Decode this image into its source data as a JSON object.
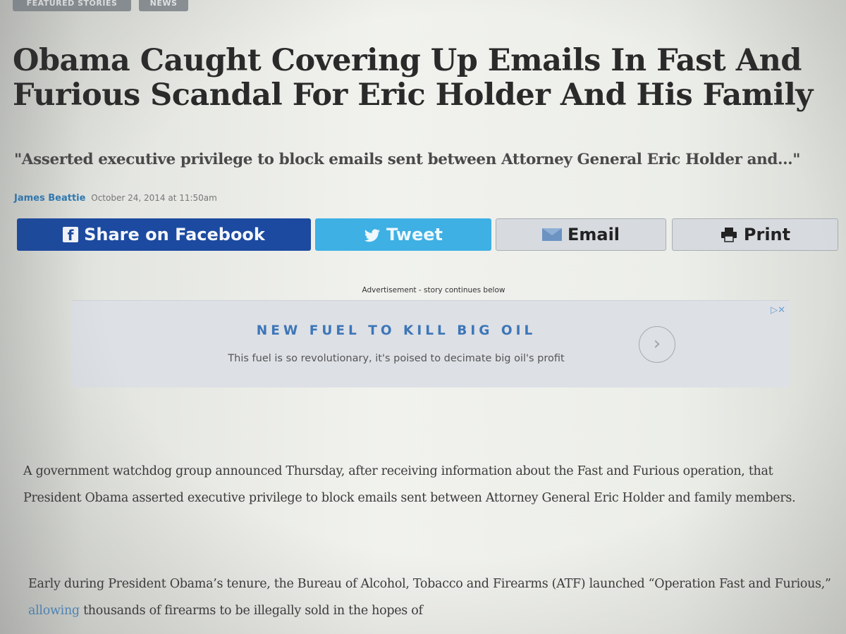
{
  "tags": [
    "FEATURED STORIES",
    "NEWS"
  ],
  "article": {
    "title": "Obama Caught Covering Up Emails In Fast And Furious Scandal For Eric Holder And His Family",
    "dek": "\"Asserted executive privilege to block emails sent between Attorney General Eric Holder and...\"",
    "author": "James Beattie",
    "date": "October 24, 2014 at 11:50am"
  },
  "share": {
    "facebook": "Share on Facebook",
    "twitter": "Tweet",
    "email": "Email",
    "print": "Print"
  },
  "ad": {
    "label": "Advertisement - story continues below",
    "close": "▷✕",
    "headline": "NEW FUEL TO KILL BIG OIL",
    "subtext": "This fuel is so revolutionary, it's poised to decimate big oil's profit",
    "arrow": "›"
  },
  "body": {
    "p1": "A government watchdog group announced Thursday, after receiving information about the Fast and Furious operation, that President Obama asserted executive privilege to block emails sent between Attorney General Eric Holder and family members.",
    "p2_before": "Early during President Obama’s tenure, the Bureau of Alcohol, Tobacco and Firearms (ATF) launched “Operation Fast and Furious,” ",
    "p2_link": "allowing",
    "p2_after": " thousands of firearms to be illegally sold in the hopes of"
  },
  "colors": {
    "facebook": "#1c4aa0",
    "twitter": "#3eb0e4",
    "link": "#2f7ab5",
    "ad_headline": "#3d76b8"
  }
}
